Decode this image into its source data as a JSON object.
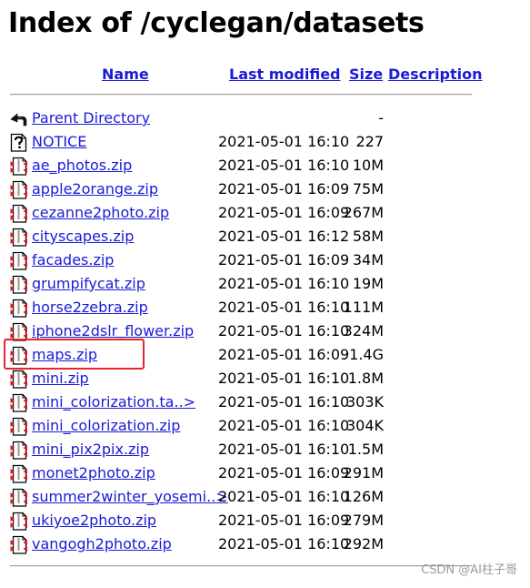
{
  "page": {
    "title": "Index of /cyclegan/datasets"
  },
  "columns": {
    "name": "Name",
    "last_modified": "Last modified",
    "size": "Size",
    "description": "Description"
  },
  "rows": [
    {
      "name": "Parent Directory",
      "date": "",
      "size": "-",
      "icon": "back-arrow-icon"
    },
    {
      "name": "NOTICE",
      "date": "2021-05-01 16:10",
      "size": "227",
      "icon": "unknown-file-icon"
    },
    {
      "name": "ae_photos.zip",
      "date": "2021-05-01 16:10",
      "size": "10M",
      "icon": "compressed-file-icon"
    },
    {
      "name": "apple2orange.zip",
      "date": "2021-05-01 16:09",
      "size": "75M",
      "icon": "compressed-file-icon"
    },
    {
      "name": "cezanne2photo.zip",
      "date": "2021-05-01 16:09",
      "size": "267M",
      "icon": "compressed-file-icon"
    },
    {
      "name": "cityscapes.zip",
      "date": "2021-05-01 16:12",
      "size": "58M",
      "icon": "compressed-file-icon"
    },
    {
      "name": "facades.zip",
      "date": "2021-05-01 16:09",
      "size": "34M",
      "icon": "compressed-file-icon"
    },
    {
      "name": "grumpifycat.zip",
      "date": "2021-05-01 16:10",
      "size": "19M",
      "icon": "compressed-file-icon"
    },
    {
      "name": "horse2zebra.zip",
      "date": "2021-05-01 16:10",
      "size": "111M",
      "icon": "compressed-file-icon"
    },
    {
      "name": "iphone2dslr_flower.zip",
      "date": "2021-05-01 16:10",
      "size": "324M",
      "icon": "compressed-file-icon"
    },
    {
      "name": "maps.zip",
      "date": "2021-05-01 16:09",
      "size": "1.4G",
      "icon": "compressed-file-icon"
    },
    {
      "name": "mini.zip",
      "date": "2021-05-01 16:10",
      "size": "1.8M",
      "icon": "compressed-file-icon"
    },
    {
      "name": "mini_colorization.ta..>",
      "date": "2021-05-01 16:10",
      "size": "303K",
      "icon": "compressed-file-icon"
    },
    {
      "name": "mini_colorization.zip",
      "date": "2021-05-01 16:10",
      "size": "304K",
      "icon": "compressed-file-icon"
    },
    {
      "name": "mini_pix2pix.zip",
      "date": "2021-05-01 16:10",
      "size": "1.5M",
      "icon": "compressed-file-icon"
    },
    {
      "name": "monet2photo.zip",
      "date": "2021-05-01 16:09",
      "size": "291M",
      "icon": "compressed-file-icon"
    },
    {
      "name": "summer2winter_yosemi..>",
      "date": "2021-05-01 16:10",
      "size": "126M",
      "icon": "compressed-file-icon"
    },
    {
      "name": "ukiyoe2photo.zip",
      "date": "2021-05-01 16:09",
      "size": "279M",
      "icon": "compressed-file-icon"
    },
    {
      "name": "vangogh2photo.zip",
      "date": "2021-05-01 16:10",
      "size": "292M",
      "icon": "compressed-file-icon"
    }
  ],
  "watermark": "CSDN @AI柱子哥",
  "colors": {
    "link": "#1a1ad9",
    "highlight": "#e3262b"
  }
}
